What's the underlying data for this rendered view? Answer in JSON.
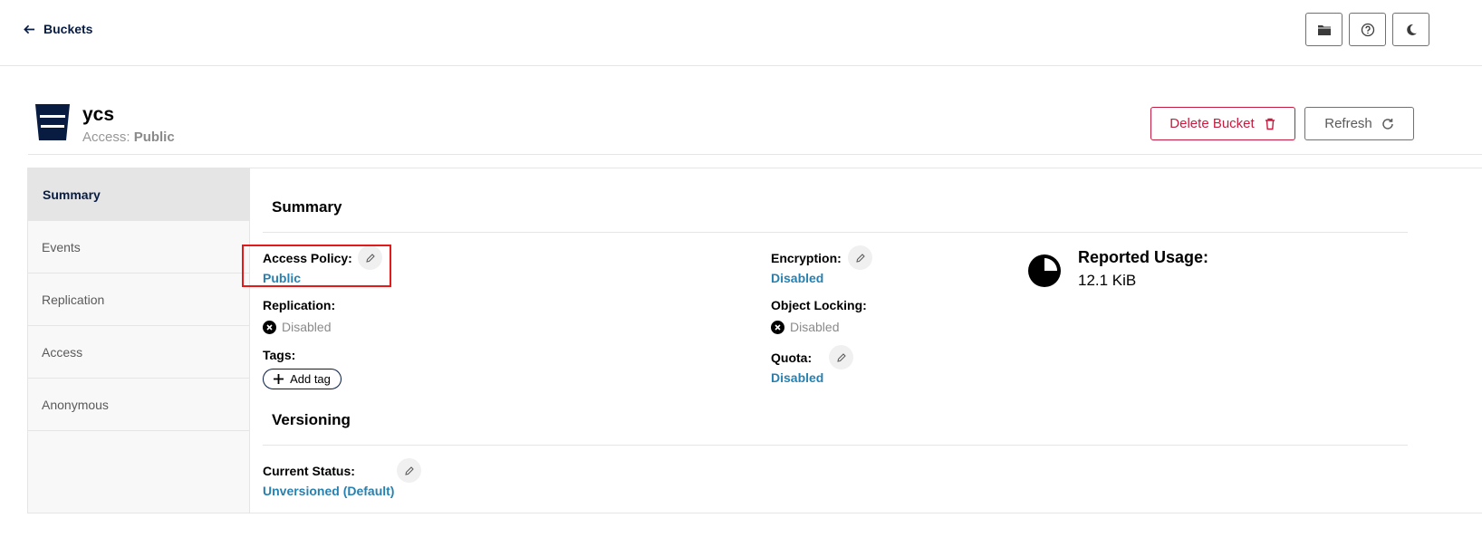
{
  "topbar": {
    "back_label": "Buckets",
    "buttons": [
      "folder-icon",
      "help-icon",
      "dark-mode-icon"
    ]
  },
  "bucket": {
    "name": "ycs",
    "access_label": "Access:",
    "access_value": "Public",
    "delete_label": "Delete Bucket",
    "refresh_label": "Refresh"
  },
  "sidebar": {
    "items": [
      {
        "label": "Summary",
        "active": true
      },
      {
        "label": "Events"
      },
      {
        "label": "Replication"
      },
      {
        "label": "Access"
      },
      {
        "label": "Anonymous"
      }
    ]
  },
  "summary": {
    "title": "Summary",
    "access_policy_label": "Access Policy:",
    "access_policy_value": "Public",
    "replication_label": "Replication:",
    "replication_value": "Disabled",
    "tags_label": "Tags:",
    "add_tag_label": "Add tag",
    "encryption_label": "Encryption:",
    "encryption_value": "Disabled",
    "object_locking_label": "Object Locking:",
    "object_locking_value": "Disabled",
    "quota_label": "Quota:",
    "quota_value": "Disabled",
    "usage_label": "Reported Usage:",
    "usage_value": "12.1 KiB"
  },
  "versioning": {
    "title": "Versioning",
    "current_status_label": "Current Status:",
    "current_status_value": "Unversioned (Default)"
  },
  "colors": {
    "brand_navy": "#081c42",
    "link_blue": "#2781b0",
    "danger_red": "#c51b3f",
    "highlight_red": "#e31a1a"
  }
}
